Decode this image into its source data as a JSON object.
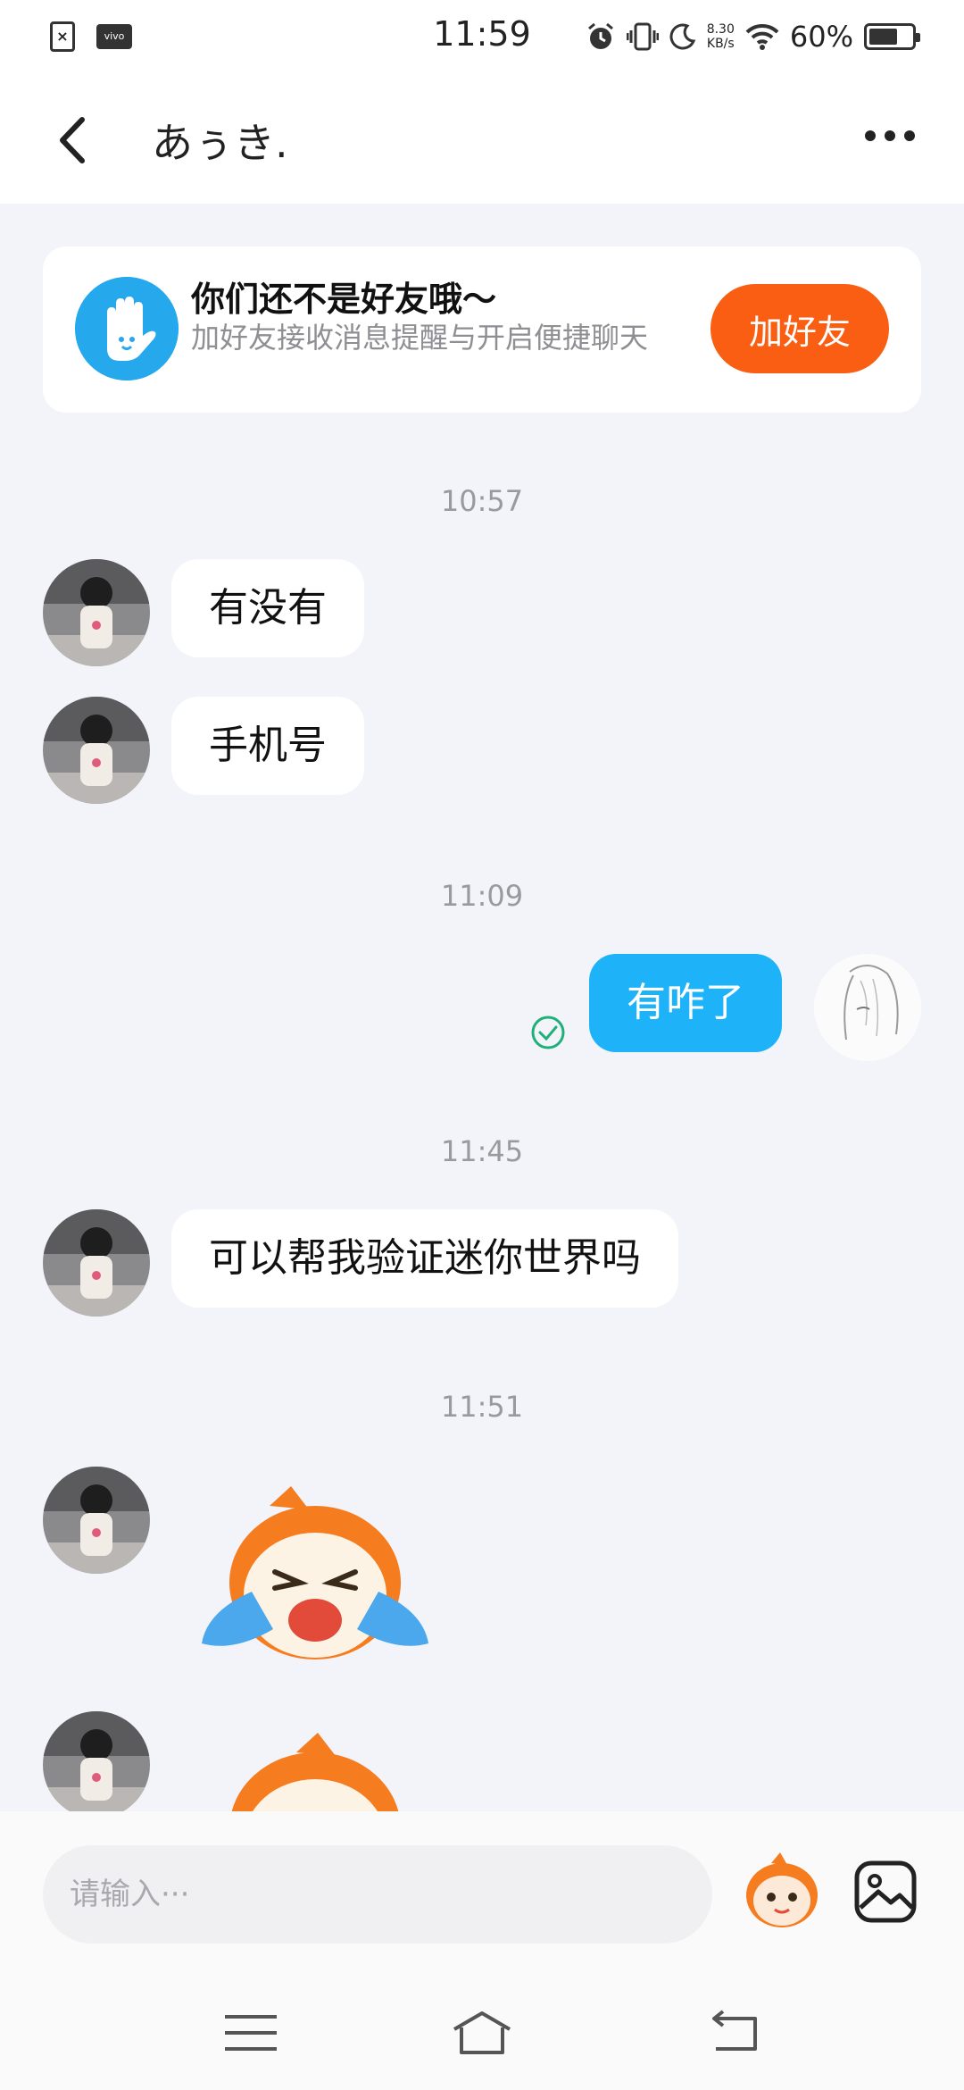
{
  "status_bar": {
    "time": "11:59",
    "network_speed_value": "8.30",
    "network_speed_unit": "KB/s",
    "battery_percent": "60%",
    "battery_level": 0.6,
    "vendor_badge": "vivo",
    "icons": [
      "sim-error-icon",
      "vivo-icon",
      "alarm-icon",
      "vibrate-icon",
      "moon-icon",
      "wifi-icon",
      "battery-icon"
    ]
  },
  "header": {
    "title": "あぅき."
  },
  "friend_prompt": {
    "title": "你们还不是好友哦～",
    "subtitle": "加好友接收消息提醒与开启便捷聊天",
    "button_label": "加好友"
  },
  "timestamps": [
    "10:57",
    "11:09",
    "11:45",
    "11:51"
  ],
  "messages": [
    {
      "from": "other",
      "text": "有没有"
    },
    {
      "from": "other",
      "text": "手机号"
    },
    {
      "from": "me",
      "text": "有咋了"
    },
    {
      "from": "other",
      "text": "可以帮我验证迷你世界吗"
    }
  ],
  "input": {
    "placeholder": "请输入···"
  },
  "colors": {
    "accent_blue": "#1eb3f8",
    "add_friend_orange": "#fa5e12",
    "background": "#f3f4f9",
    "sent_check_green": "#1fb07a"
  }
}
